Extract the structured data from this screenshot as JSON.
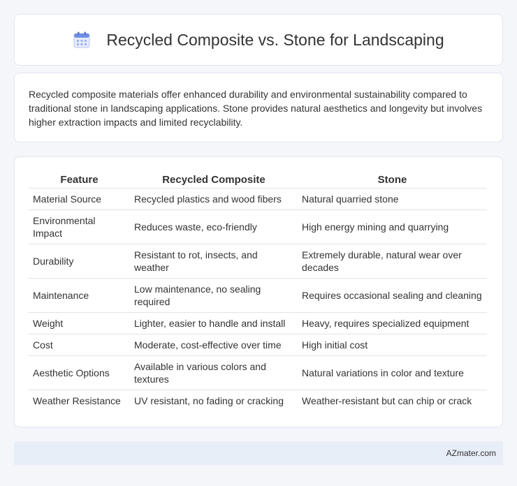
{
  "header": {
    "title": "Recycled Composite vs. Stone for Landscaping",
    "icon": "calendar-icon"
  },
  "summary": {
    "text": "Recycled composite materials offer enhanced durability and environmental sustainability compared to traditional stone in landscaping applications. Stone provides natural aesthetics and longevity but involves higher extraction impacts and limited recyclability."
  },
  "table": {
    "headers": [
      "Feature",
      "Recycled Composite",
      "Stone"
    ],
    "rows": [
      [
        "Material Source",
        "Recycled plastics and wood fibers",
        "Natural quarried stone"
      ],
      [
        "Environmental Impact",
        "Reduces waste, eco-friendly",
        "High energy mining and quarrying"
      ],
      [
        "Durability",
        "Resistant to rot, insects, and weather",
        "Extremely durable, natural wear over decades"
      ],
      [
        "Maintenance",
        "Low maintenance, no sealing required",
        "Requires occasional sealing and cleaning"
      ],
      [
        "Weight",
        "Lighter, easier to handle and install",
        "Heavy, requires specialized equipment"
      ],
      [
        "Cost",
        "Moderate, cost-effective over time",
        "High initial cost"
      ],
      [
        "Aesthetic Options",
        "Available in various colors and textures",
        "Natural variations in color and texture"
      ],
      [
        "Weather Resistance",
        "UV resistant, no fading or cracking",
        "Weather-resistant but can chip or crack"
      ]
    ]
  },
  "footer": {
    "text": "AZmater.com"
  }
}
